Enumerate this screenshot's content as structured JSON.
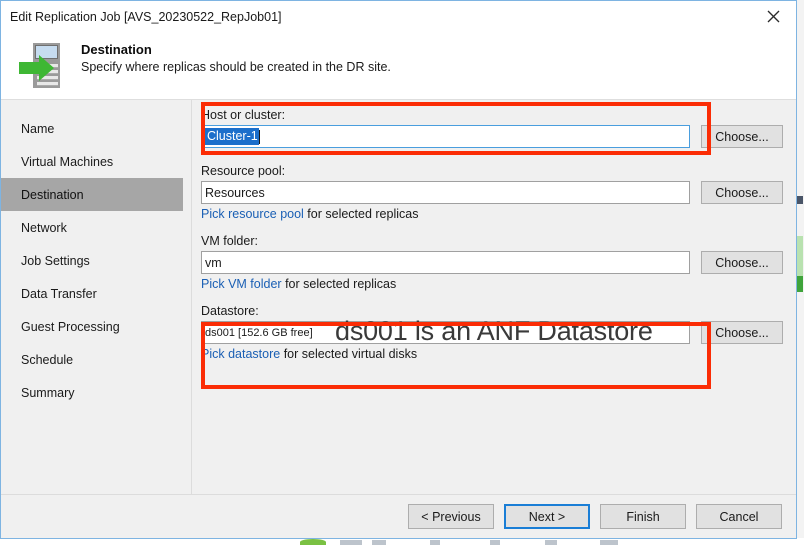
{
  "window": {
    "title": "Edit Replication Job [AVS_20230522_RepJob01]",
    "close_icon": "close-icon"
  },
  "header": {
    "icon": "replication-destination-icon",
    "title": "Destination",
    "subtitle": "Specify where replicas should be created in the DR site."
  },
  "sidebar": {
    "items": [
      {
        "label": "Name",
        "selected": false
      },
      {
        "label": "Virtual Machines",
        "selected": false
      },
      {
        "label": "Destination",
        "selected": true
      },
      {
        "label": "Network",
        "selected": false
      },
      {
        "label": "Job Settings",
        "selected": false
      },
      {
        "label": "Data Transfer",
        "selected": false
      },
      {
        "label": "Guest Processing",
        "selected": false
      },
      {
        "label": "Schedule",
        "selected": false
      },
      {
        "label": "Summary",
        "selected": false
      }
    ]
  },
  "form": {
    "host": {
      "label": "Host or cluster:",
      "value": "Cluster-1",
      "choose_label": "Choose..."
    },
    "resource_pool": {
      "label": "Resource pool:",
      "value": "Resources",
      "choose_label": "Choose...",
      "hint_link": "Pick resource pool",
      "hint_rest": " for selected replicas"
    },
    "vm_folder": {
      "label": "VM folder:",
      "value": "vm",
      "choose_label": "Choose...",
      "hint_link": "Pick VM folder",
      "hint_rest": " for selected replicas"
    },
    "datastore": {
      "label": "Datastore:",
      "value": "ds001 [152.6 GB free]",
      "choose_label": "Choose...",
      "hint_link": "Pick datastore",
      "hint_rest": " for selected virtual disks"
    }
  },
  "annotations": {
    "datastore_note": "ds001 is an ANF Datastore",
    "highlight_color": "#fb2c05"
  },
  "footer": {
    "previous_label": "< Previous",
    "next_label": "Next >",
    "finish_label": "Finish",
    "cancel_label": "Cancel"
  }
}
